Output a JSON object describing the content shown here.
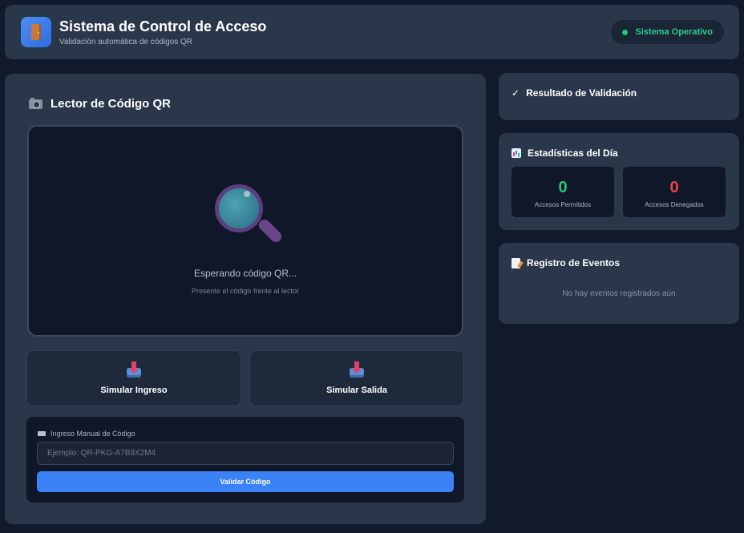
{
  "header": {
    "title": "Sistema de Control de Acceso",
    "subtitle": "Validación automática de códigos QR",
    "app_icon": "door-icon",
    "status_label": "Sistema Operativo",
    "status_color": "#22c77e"
  },
  "scanner": {
    "heading": "Lector de Código QR",
    "heading_icon": "camera-icon",
    "viewport_icon": "magnifier-icon",
    "waiting_text": "Esperando código QR...",
    "waiting_hint": "Presente el código frente al lector"
  },
  "simulate": {
    "entry_label": "Simular Ingreso",
    "exit_label": "Simular Salida",
    "icon": "inbox-tray-icon"
  },
  "manual": {
    "label": "Ingreso Manual de Código",
    "label_icon": "keyboard-icon",
    "input_value": "",
    "input_placeholder": "Ejemplo: QR-PKG-A7B9X2M4",
    "validate_label": "Validar Código",
    "button_color": "#3b82f6"
  },
  "result": {
    "title": "Resultado de Validación",
    "icon": "check-icon"
  },
  "stats": {
    "title": "Estadísticas del Día",
    "icon": "bar-chart-icon",
    "allowed_value": "0",
    "allowed_label": "Accesos Permitidos",
    "allowed_color": "#22c77e",
    "denied_value": "0",
    "denied_label": "Accesos Denegados",
    "denied_color": "#ef4444"
  },
  "log": {
    "title": "Registro de Eventos",
    "icon": "memo-icon",
    "empty_text": "No hay eventos registrados aún"
  }
}
